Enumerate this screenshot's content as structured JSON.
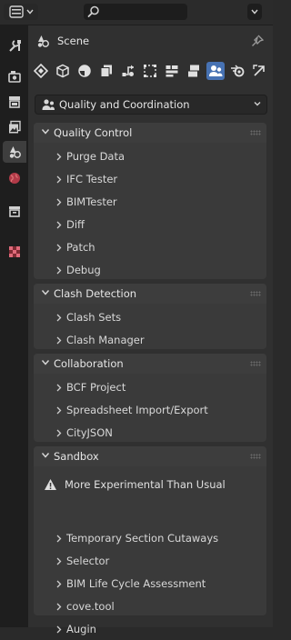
{
  "header": {
    "context_label": "Scene"
  },
  "panel_selector": {
    "value": "Quality and Coordination"
  },
  "panels": [
    {
      "title": "Quality Control",
      "items": [
        "Purge Data",
        "IFC Tester",
        "BIMTester",
        "Diff",
        "Patch",
        "Debug"
      ]
    },
    {
      "title": "Clash Detection",
      "items": [
        "Clash Sets",
        "Clash Manager"
      ]
    },
    {
      "title": "Collaboration",
      "items": [
        "BCF Project",
        "Spreadsheet Import/Export",
        "CityJSON"
      ]
    },
    {
      "title": "Sandbox",
      "warning": "More Experimental Than Usual",
      "items": [
        "Temporary Section Cutaways",
        "Selector",
        "BIM Life Cycle Assessment",
        "cove.tool",
        "Augin"
      ]
    }
  ],
  "icons": {
    "editor_type": "properties-editor-icon",
    "search": "search-icon",
    "tabs": [
      "tool-icon",
      "render-icon",
      "output-icon",
      "view-layer-icon",
      "scene-icon",
      "world-icon",
      "collection-icon",
      "texture-icon"
    ],
    "context_tabs": [
      "project-icon",
      "object-icon",
      "geometry-icon",
      "drawings-icon",
      "services-icon",
      "structural-icon",
      "schedule-icon",
      "facility-icon",
      "quality-icon",
      "blender-icon",
      "migrate-icon"
    ]
  },
  "colors": {
    "accent": "#4772b3",
    "background": "#303030",
    "panel": "#3a3a3a"
  }
}
